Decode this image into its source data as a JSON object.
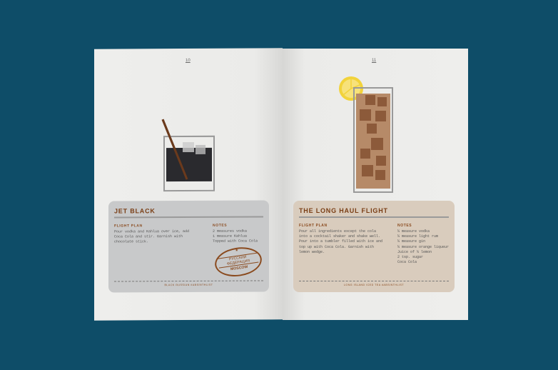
{
  "left_page": {
    "page_number": "10",
    "card": {
      "title": "JET BLACK",
      "flight_plan_heading": "FLIGHT PLAN",
      "flight_plan": "Pour vodka and Kahlua over ice, add Coca Cola and stir. Garnish with chocolate stick.",
      "notes_heading": "NOTES",
      "notes": [
        "2 measures vodka",
        "1 measure Kahlua",
        "Topped with Coca Cola"
      ],
      "stamp": {
        "star": "★",
        "text": "РУССКИЙ ФЕДЕРАЦИЯ",
        "city": "MOSCOW"
      },
      "footer": "BLACK RUSSIAN #ABSINTHLIST"
    }
  },
  "right_page": {
    "page_number": "11",
    "card": {
      "title": "THE LONG HAUL FLIGHT",
      "flight_plan_heading": "FLIGHT PLAN",
      "flight_plan": "Pour all ingredients except the cola into a cocktail shaker and shake well. Pour into a tumbler filled with ice and top up with Coca Cola. Garnish with lemon wedge.",
      "notes_heading": "NOTES",
      "notes": [
        "¼ measure vodka",
        "¼ measure light rum",
        "¼ measure gin",
        "¼ measure orange liqueur",
        "Juice of ¼ lemon",
        "2 tsp. sugar",
        "Coca Cola"
      ],
      "footer": "LONG ISLAND ICED TEA #ABSINTHLIST"
    }
  },
  "colors": {
    "background": "#0e4d68",
    "accent": "#7a3e15"
  }
}
